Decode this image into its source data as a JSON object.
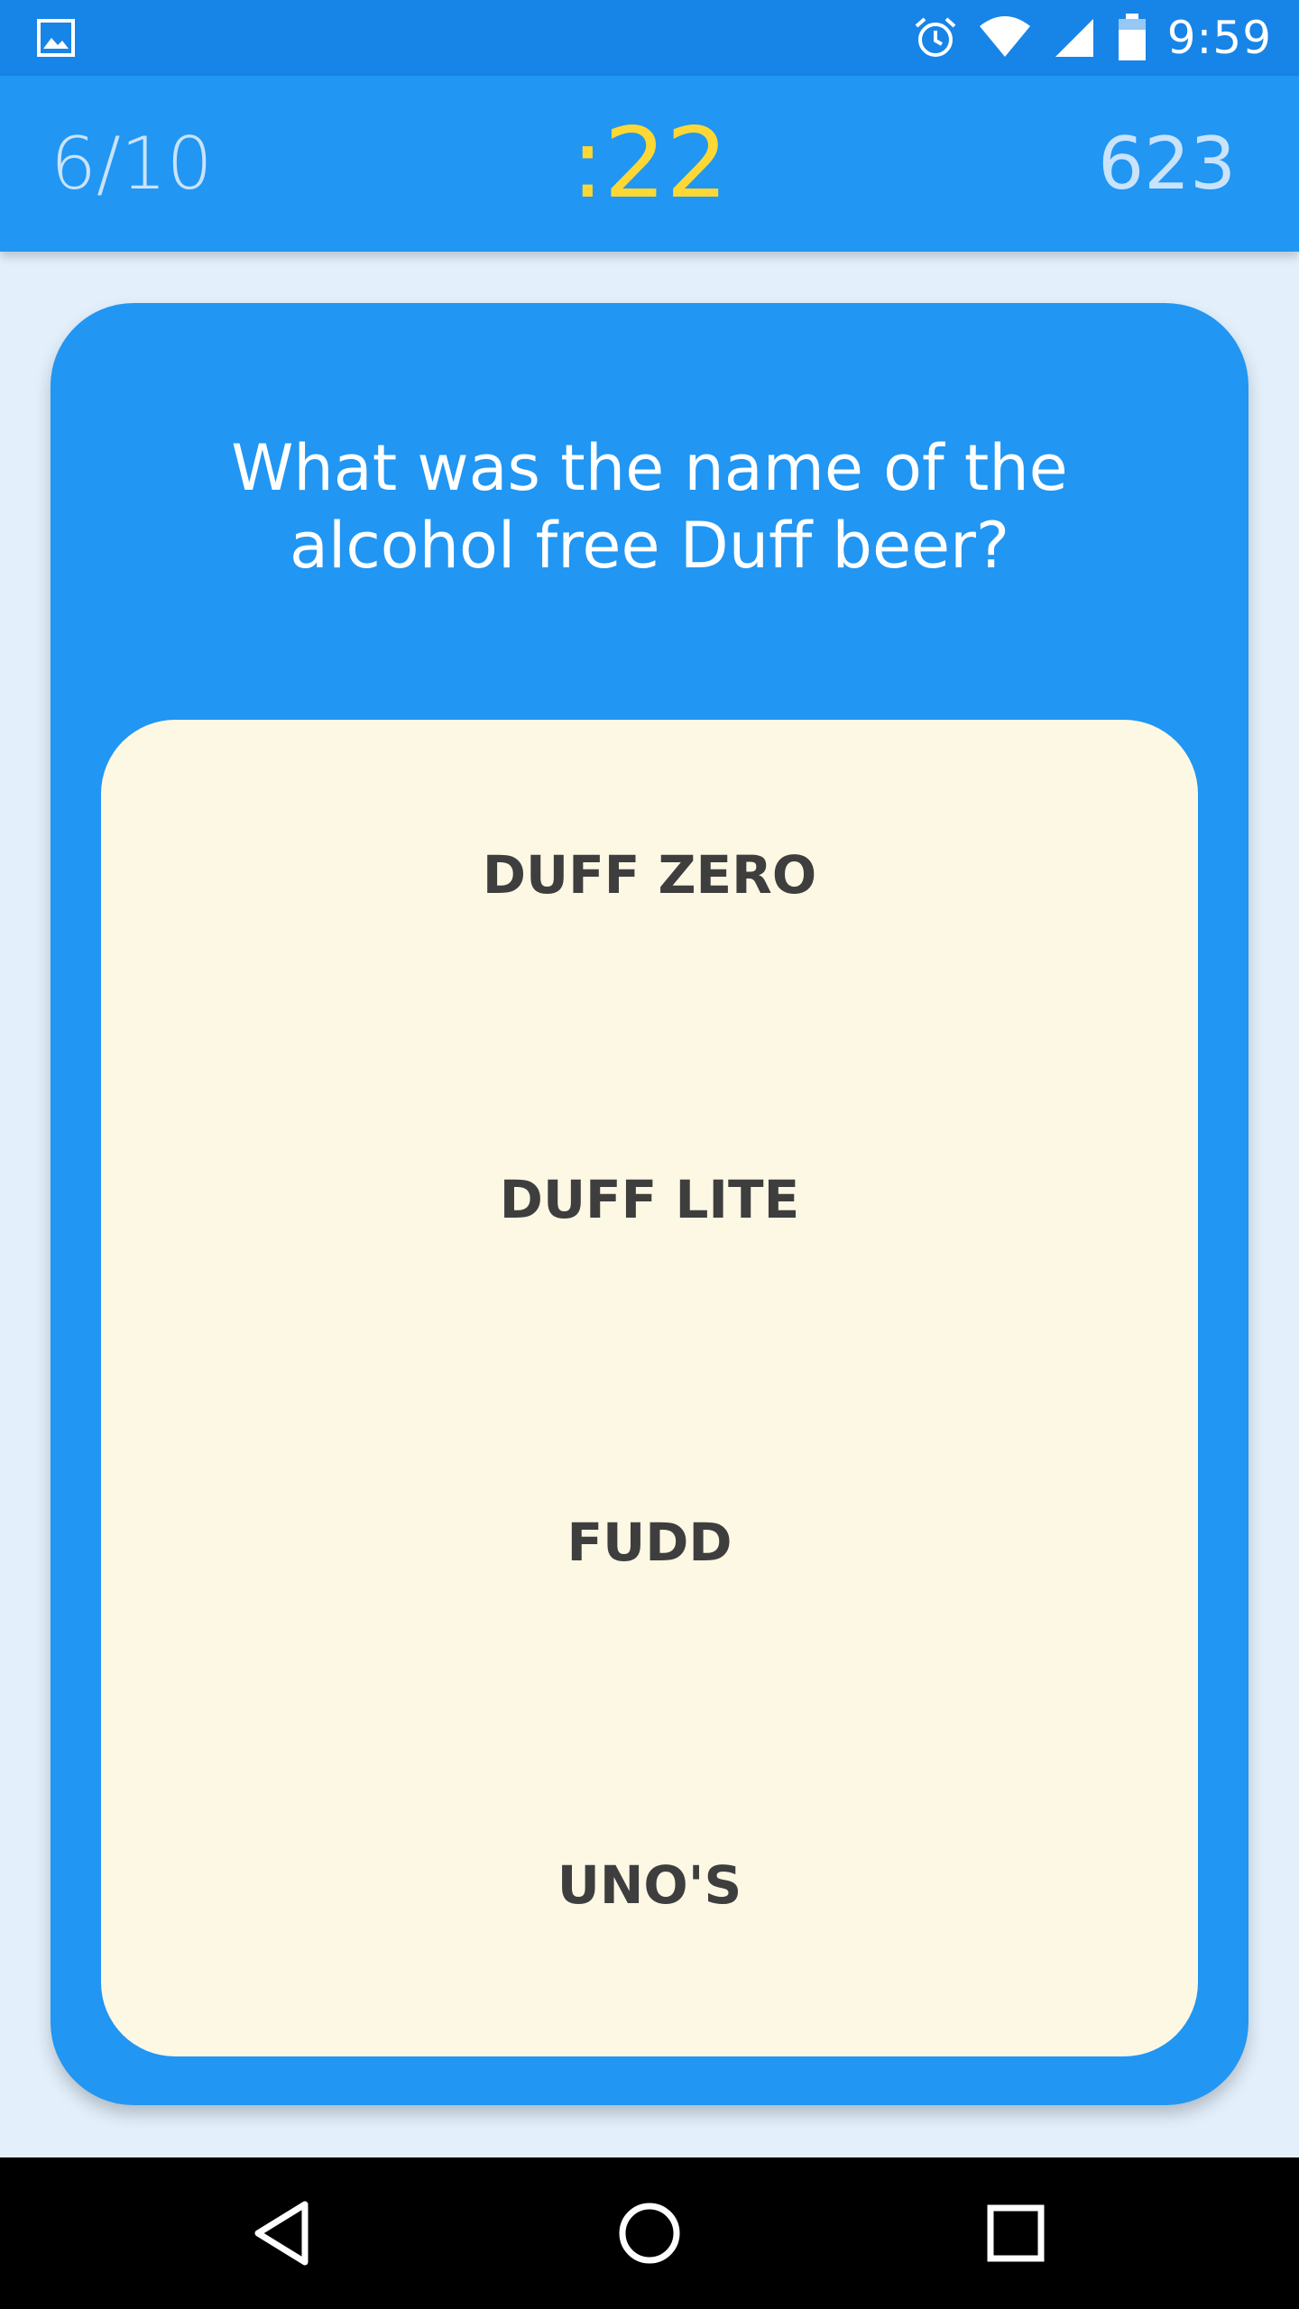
{
  "status_bar": {
    "time": "9:59",
    "icons": [
      "gallery-icon",
      "alarm-icon",
      "wifi-icon",
      "cell-signal-icon",
      "battery-icon"
    ]
  },
  "toolbar": {
    "progress": "6/10",
    "timer": ":22",
    "score": "623"
  },
  "question": {
    "text": "What was the name of the alcohol free Duff beer?"
  },
  "answers": [
    {
      "label": "DUFF ZERO"
    },
    {
      "label": "DUFF LITE"
    },
    {
      "label": "FUDD"
    },
    {
      "label": "UNO'S"
    }
  ],
  "nav_bar": {
    "icons": [
      "back-icon",
      "home-icon",
      "recents-icon"
    ]
  },
  "colors": {
    "status_bar": "#1784e8",
    "toolbar": "#2196f3",
    "timer": "#fdd835",
    "card": "#2196f3",
    "answers_panel": "#fdf8e4",
    "background": "#e3f0fc"
  }
}
